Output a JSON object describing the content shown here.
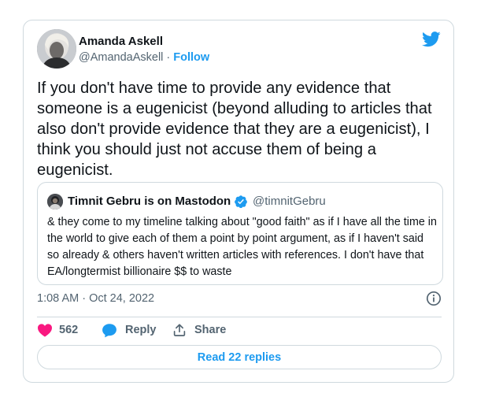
{
  "author": {
    "name": "Amanda Askell",
    "handle": "@AmandaAskell",
    "separator": "·",
    "follow_label": "Follow"
  },
  "tweet": {
    "text": "If you don't have time to provide any evidence that someone is a eugenicist (beyond alluding to articles that also don't provide evidence that they are a eugenicist), I think you should just not accuse them of being a eugenicist."
  },
  "quoted_tweet": {
    "name": "Timnit Gebru is on Mastodon",
    "handle": "@timnitGebru",
    "text": "& they come to my timeline talking about \"good faith\" as if I have all the time in the world to give each of them a point by point argument, as if I haven't said so already & others haven't written articles with references. I don't have that EA/longtermist billionaire $$ to waste"
  },
  "meta": {
    "timestamp": "1:08 AM · Oct 24, 2022"
  },
  "actions": {
    "like_count": "562",
    "reply_label": "Reply",
    "share_label": "Share"
  },
  "read_replies_label": "Read 22 replies",
  "colors": {
    "accent": "#1d9bf0",
    "like": "#f91880",
    "text": "#0f1419",
    "muted": "#536471",
    "border": "#cfd9de"
  },
  "icons": [
    "twitter-bird-icon",
    "verified-badge-icon",
    "info-icon",
    "heart-icon",
    "reply-bubble-icon",
    "share-icon"
  ]
}
